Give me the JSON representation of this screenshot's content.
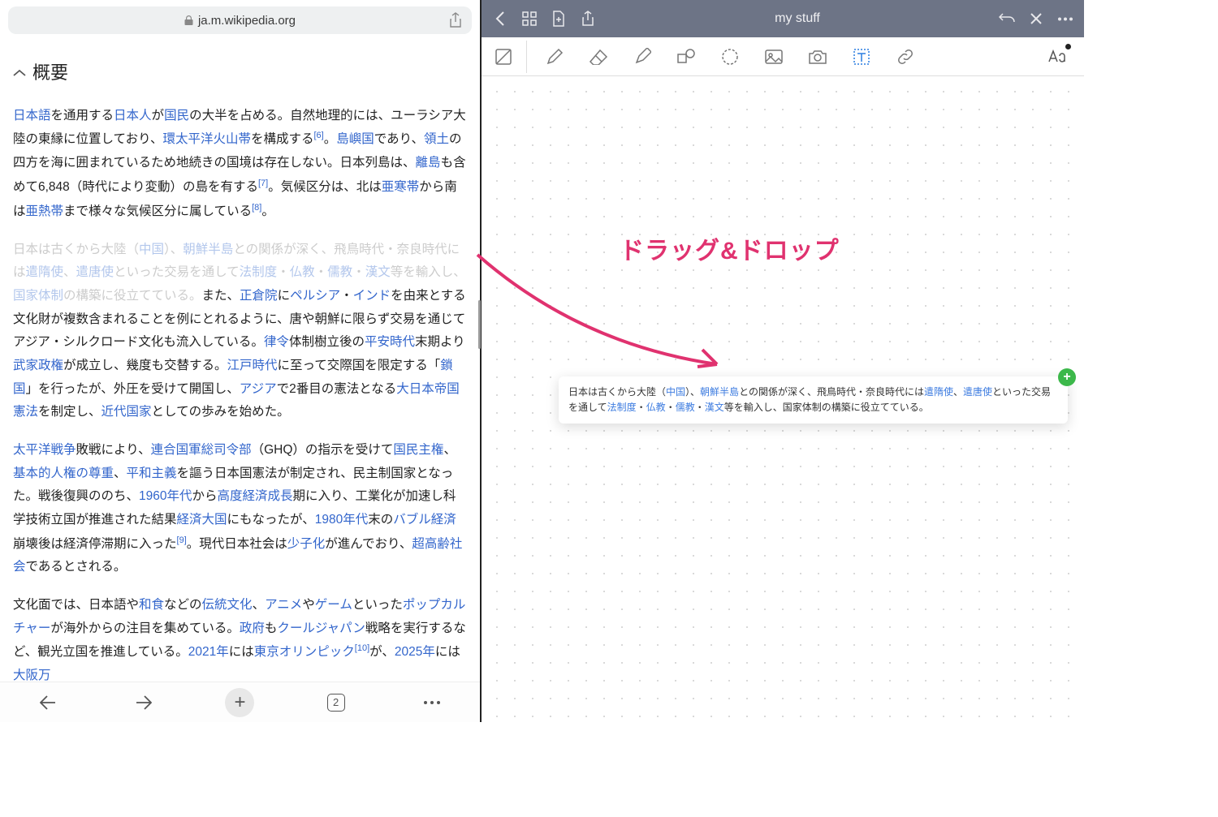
{
  "browser": {
    "url": "ja.m.wikipedia.org",
    "tab_count": "2",
    "section_title": "概要"
  },
  "article": {
    "p1_parts": [
      "日本語",
      "を通用する",
      "日本人",
      "が",
      "国民",
      "の大半を占める。自然地理的には、ユーラシア大陸の東縁に位置しており、",
      "環太平洋火山帯",
      "を構成する",
      "[6]",
      "。",
      "島嶼国",
      "であり、",
      "領土",
      "の四方を海に囲まれているため地続きの国境は存在しない。日本列島は、",
      "離島",
      "も含めて6,848（時代により変動）の島を有する",
      "[7]",
      "。気候区分は、北は",
      "亜寒帯",
      "から南は",
      "亜熱帯",
      "まで様々な気候区分に属している",
      "[8]",
      "。"
    ],
    "p2_faded": [
      "日本は古くから大陸（",
      "中国",
      "）、",
      "朝鮮半島",
      "との関係が深く、飛鳥時代・奈良時代には",
      "遣隋使",
      "、",
      "遣唐使",
      "といった交易を通して",
      "法制度",
      "・",
      "仏教",
      "・",
      "儒教",
      "・",
      "漢文",
      "等を輸入し、",
      "国家体制",
      "の構築に役立てている。"
    ],
    "p2_rest": [
      "また、",
      "正倉院",
      "に",
      "ペルシア",
      "・",
      "インド",
      "を由来とする文化財が複数含まれることを例にとれるように、唐や朝鮮に限らず交易を通じてアジア・シルクロード文化も流入している。",
      "律令",
      "体制樹立後の",
      "平安時代",
      "末期より",
      "武家政権",
      "が成立し、幾度も交替する。",
      "江戸時代",
      "に至って交際国を限定する「",
      "鎖国",
      "」を行ったが、外圧を受けて開国し、",
      "アジア",
      "で2番目の憲法となる",
      "大日本帝国憲法",
      "を制定し、",
      "近代国家",
      "としての歩みを始めた。"
    ],
    "p3_parts": [
      "太平洋戦争",
      "敗戦により、",
      "連合国軍総司令部",
      "（GHQ）の指示を受けて",
      "国民主権",
      "、",
      "基本的人権の尊重",
      "、",
      "平和主義",
      "を謳う日本国憲法が制定され、民主制国家となった。戦後復興ののち、",
      "1960年代",
      "から",
      "高度経済成長",
      "期に入り、工業化が加速し科学技術立国が推進された結果",
      "経済大国",
      "にもなったが、",
      "1980年代",
      "末の",
      "バブル経済",
      "崩壊後は経済停滞期に入った",
      "[9]",
      "。現代日本社会は",
      "少子化",
      "が進んでおり、",
      "超高齢社会",
      "であるとされる。"
    ],
    "p4_parts": [
      "文化面では、日本語や",
      "和食",
      "などの",
      "伝統文化",
      "、",
      "アニメ",
      "や",
      "ゲーム",
      "といった",
      "ポップカルチャー",
      "が海外からの注目を集めている。",
      "政府",
      "も",
      "クールジャパン",
      "戦略を実行するなど、観光立国を推進している。",
      "2021年",
      "には",
      "東京オリンピック",
      "[10]",
      "が、",
      "2025年",
      "には",
      "大阪万"
    ]
  },
  "notes": {
    "title": "my stuff",
    "annotation": "ドラッグ&ドロップ"
  },
  "card": {
    "parts": [
      "日本は古くから大陸（",
      "中国",
      "）、",
      "朝鮮半島",
      "との関係が深く、飛鳥時代・奈良時代には",
      "遣隋使",
      "、",
      "遣唐使",
      "といった交易を通して",
      "法制度",
      "・",
      "仏教",
      "・",
      "儒教",
      "・",
      "漢文",
      "等を輸入し、国家体制の構築に役立てている。"
    ]
  }
}
